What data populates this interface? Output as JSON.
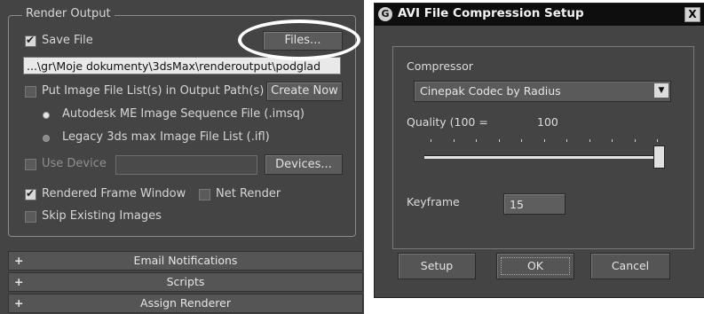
{
  "render_output": {
    "group_title": "Render Output",
    "save_file_label": "Save File",
    "save_file_checked": true,
    "files_button": "Files...",
    "output_path": "...\\gr\\Moje dokumenty\\3dsMax\\renderoutput\\podglad",
    "put_image_label": "Put Image File List(s) in Output Path(s)",
    "create_now_button": "Create Now",
    "radio_autodesk": "Autodesk ME Image Sequence File (.imsq)",
    "radio_legacy": "Legacy 3ds max Image File List (.ifl)",
    "use_device_label": "Use Device",
    "devices_button": "Devices...",
    "rendered_frame_window_label": "Rendered Frame Window",
    "rendered_frame_window_checked": true,
    "net_render_label": "Net Render",
    "skip_existing_label": "Skip Existing Images"
  },
  "rollouts": [
    {
      "label": "Email Notifications",
      "icon": "+"
    },
    {
      "label": "Scripts",
      "icon": "+"
    },
    {
      "label": "Assign Renderer",
      "icon": "+"
    }
  ],
  "avi_dialog": {
    "title": "AVI File Compression Setup",
    "app_icon": "G",
    "close_icon": "X",
    "compressor_label": "Compressor",
    "compressor_value": "Cinepak Codec by Radius",
    "dropdown_arrow": "▼",
    "quality_label": "Quality (100 =",
    "quality_value": "100",
    "quality_slider": 100,
    "keyframe_label": "Keyframe",
    "keyframe_value": "15",
    "setup_button": "Setup",
    "ok_button": "OK",
    "cancel_button": "Cancel"
  },
  "colors": {
    "panel_bg": "#444444",
    "titlebar_bg": "#0e0e0e",
    "highlight_oval": "#ffffff"
  }
}
